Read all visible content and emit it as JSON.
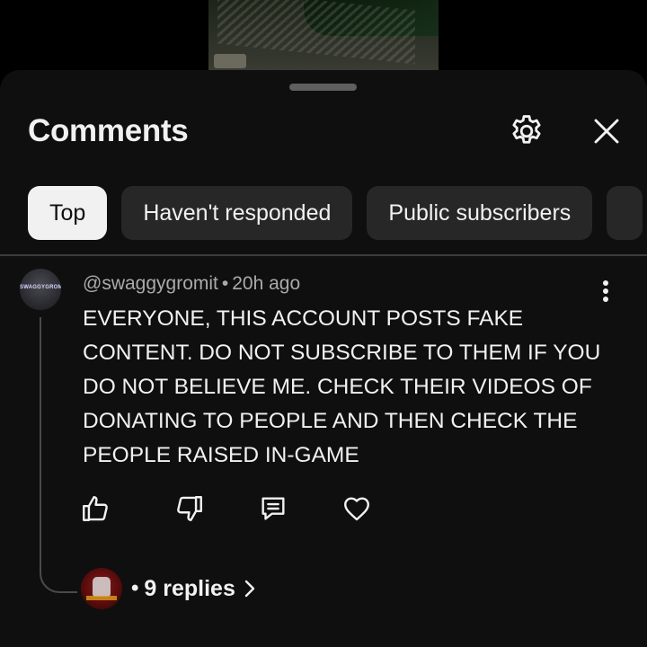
{
  "panel": {
    "title": "Comments"
  },
  "chips": [
    {
      "label": "Top",
      "selected": true
    },
    {
      "label": "Haven't responded",
      "selected": false
    },
    {
      "label": "Public subscribers",
      "selected": false
    }
  ],
  "comment": {
    "author": "@swaggygromit",
    "separator": "•",
    "time": "20h ago",
    "avatar_text": "SWAGGYGROMIT",
    "text": "EVERYONE, THIS ACCOUNT POSTS FAKE CONTENT. DO NOT SUBSCRIBE TO THEM IF YOU DO NOT BELIEVE ME. CHECK THEIR VIDEOS OF DONATING TO PEOPLE AND THEN CHECK THE PEOPLE RAISED IN-GAME",
    "actions": [
      "thumbs-up-icon",
      "thumbs-down-icon",
      "reply-icon",
      "heart-icon"
    ]
  },
  "replies": {
    "dot": "•",
    "label": "9 replies"
  },
  "colors": {
    "background": "#0f0f0f",
    "chip_bg": "#272727",
    "chip_active_bg": "#f1f1f1",
    "text_primary": "#f1f1f1",
    "text_secondary": "#aaaaaa"
  }
}
